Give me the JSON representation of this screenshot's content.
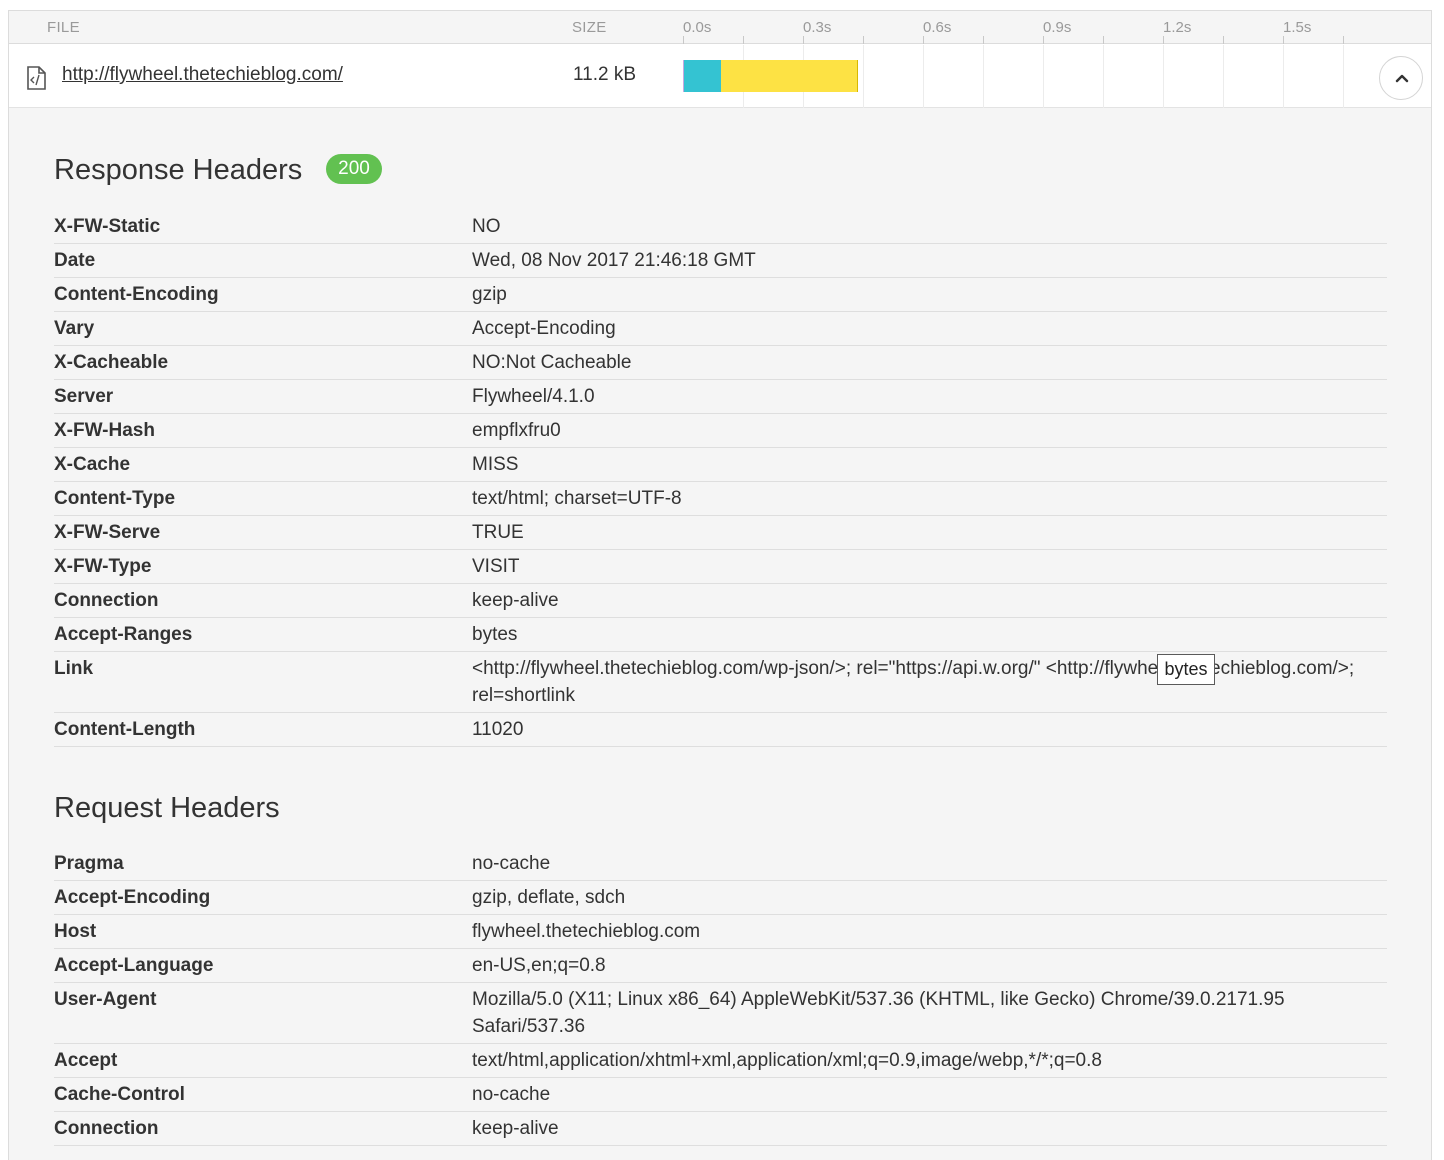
{
  "columns": {
    "file": "FILE",
    "size": "SIZE",
    "ticks": [
      "0.0s",
      "0.3s",
      "0.6s",
      "0.9s",
      "1.2s",
      "1.5s"
    ]
  },
  "request": {
    "url": "http://flywheel.thetechieblog.com/",
    "size": "11.2 kB",
    "icon": "html-file-icon",
    "timing": [
      {
        "phase": "connect",
        "start_s": 0.0,
        "end_s": 0.003,
        "color": "#c7a8e0"
      },
      {
        "phase": "wait",
        "start_s": 0.003,
        "end_s": 0.095,
        "color": "#34c3d2"
      },
      {
        "phase": "receive",
        "start_s": 0.095,
        "end_s": 0.435,
        "color": "#fde244"
      }
    ],
    "collapse_icon": "chevron-up-icon"
  },
  "response": {
    "title": "Response Headers",
    "status": "200",
    "status_color": "#62c151",
    "headers": [
      {
        "key": "X-FW-Static",
        "value": "NO"
      },
      {
        "key": "Date",
        "value": "Wed, 08 Nov 2017 21:46:18 GMT"
      },
      {
        "key": "Content-Encoding",
        "value": "gzip"
      },
      {
        "key": "Vary",
        "value": "Accept-Encoding"
      },
      {
        "key": "X-Cacheable",
        "value": "NO:Not Cacheable"
      },
      {
        "key": "Server",
        "value": "Flywheel/4.1.0"
      },
      {
        "key": "X-FW-Hash",
        "value": "empflxfru0"
      },
      {
        "key": "X-Cache",
        "value": "MISS"
      },
      {
        "key": "Content-Type",
        "value": "text/html; charset=UTF-8"
      },
      {
        "key": "X-FW-Serve",
        "value": "TRUE"
      },
      {
        "key": "X-FW-Type",
        "value": "VISIT"
      },
      {
        "key": "Connection",
        "value": "keep-alive"
      },
      {
        "key": "Accept-Ranges",
        "value": "bytes"
      },
      {
        "key": "Link",
        "value": "<http://flywheel.thetechieblog.com/wp-json/>; rel=\"https://api.w.org/\" <http://flywheel.thetechieblog.com/>; rel=shortlink"
      },
      {
        "key": "Content-Length",
        "value": "11020"
      }
    ]
  },
  "request_headers": {
    "title": "Request Headers",
    "headers": [
      {
        "key": "Pragma",
        "value": "no-cache"
      },
      {
        "key": "Accept-Encoding",
        "value": "gzip, deflate, sdch"
      },
      {
        "key": "Host",
        "value": "flywheel.thetechieblog.com"
      },
      {
        "key": "Accept-Language",
        "value": "en-US,en;q=0.8"
      },
      {
        "key": "User-Agent",
        "value": "Mozilla/5.0 (X11; Linux x86_64) AppleWebKit/537.36 (KHTML, like Gecko) Chrome/39.0.2171.95 Safari/537.36"
      },
      {
        "key": "Accept",
        "value": "text/html,application/xhtml+xml,application/xml;q=0.9,image/webp,*/*;q=0.8"
      },
      {
        "key": "Cache-Control",
        "value": "no-cache"
      },
      {
        "key": "Connection",
        "value": "keep-alive"
      }
    ]
  },
  "tooltip": {
    "text": "bytes"
  }
}
